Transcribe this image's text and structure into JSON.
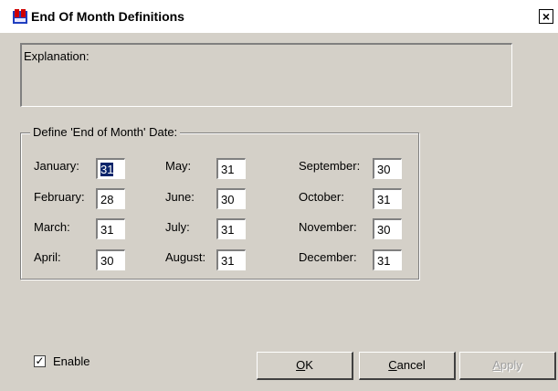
{
  "window": {
    "title": "End Of Month Definitions",
    "close_label": "×"
  },
  "explanation": {
    "label": "Explanation:"
  },
  "group": {
    "title": "Define 'End of Month' Date:",
    "months": [
      {
        "label": "January:",
        "value": "31"
      },
      {
        "label": "February:",
        "value": "28"
      },
      {
        "label": "March:",
        "value": "31"
      },
      {
        "label": "April:",
        "value": "30"
      },
      {
        "label": "May:",
        "value": "31"
      },
      {
        "label": "June:",
        "value": "30"
      },
      {
        "label": "July:",
        "value": "31"
      },
      {
        "label": "August:",
        "value": "31"
      },
      {
        "label": "September:",
        "value": "30"
      },
      {
        "label": "October:",
        "value": "31"
      },
      {
        "label": "November:",
        "value": "30"
      },
      {
        "label": "December:",
        "value": "31"
      }
    ]
  },
  "enable": {
    "label": "Enable",
    "checked": true,
    "mark": "✓"
  },
  "buttons": {
    "ok": "OK",
    "cancel": "Cancel",
    "apply": "Apply"
  },
  "colors": {
    "title_icon": "#c00000",
    "selection": "#0a246a"
  }
}
